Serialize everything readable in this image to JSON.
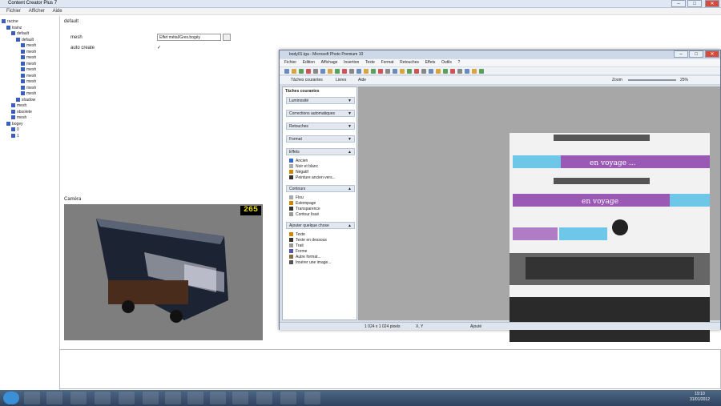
{
  "back_window": {
    "title": "Content Creator Plus 7",
    "menu": [
      "Fichier",
      "Afficher",
      "Aide"
    ],
    "tree": [
      "racine",
      "trainz",
      "default",
      "default",
      "mesh",
      "mesh",
      "mesh",
      "mesh",
      "mesh",
      "mesh",
      "mesh",
      "mesh",
      "mesh",
      "shadow",
      "mesh",
      "obsolete",
      "mesh",
      "bogey",
      "0",
      "1"
    ],
    "props": {
      "section": "default",
      "field1_label": "mesh",
      "field1_value": "Effet métal/Gres.bogéy",
      "field2_label": "auto create",
      "checkbox": "✓"
    },
    "camera_label": "Caméra",
    "fps": "265"
  },
  "paint_window": {
    "title": "body01.tga - Microsoft Photo Premium 10",
    "menu": [
      "Fichier",
      "Edition",
      "Affichage",
      "Insertion",
      "Texte",
      "Format",
      "Retouches",
      "Effets",
      "Outils",
      "?"
    ],
    "tool_tabs": [
      "Tâches courantes",
      "Livres",
      "Aide"
    ],
    "zoom_label": "Zoom",
    "zoom_value": "25%",
    "panel_title": "Tâches courantes",
    "sections": [
      {
        "label": "Luminosité",
        "items": []
      },
      {
        "label": "Corrections automatiques",
        "items": []
      },
      {
        "label": "Retouches",
        "items": []
      },
      {
        "label": "Format",
        "items": []
      },
      {
        "label": "Effets",
        "items": [
          "Ancien",
          "Noir et blanc",
          "Négatif",
          "Peinture ancien vers..."
        ]
      },
      {
        "label": "Contours",
        "items": [
          "Flou",
          "Estompage",
          "Transparence",
          "Contour lissé"
        ]
      },
      {
        "label": "Ajouter quelque chose",
        "items": [
          "Texte",
          "Texte en dessous",
          "Trait",
          "Forme",
          "Autre format...",
          "Insérer une image..."
        ]
      }
    ],
    "texture_text": [
      "en voyage ...",
      "en voyage"
    ],
    "status": [
      "1 024 x 1 024 pixels",
      "X, Y",
      "Ajouté"
    ]
  },
  "taskbar": {
    "time": "19:10",
    "date": "31/01/2012"
  }
}
